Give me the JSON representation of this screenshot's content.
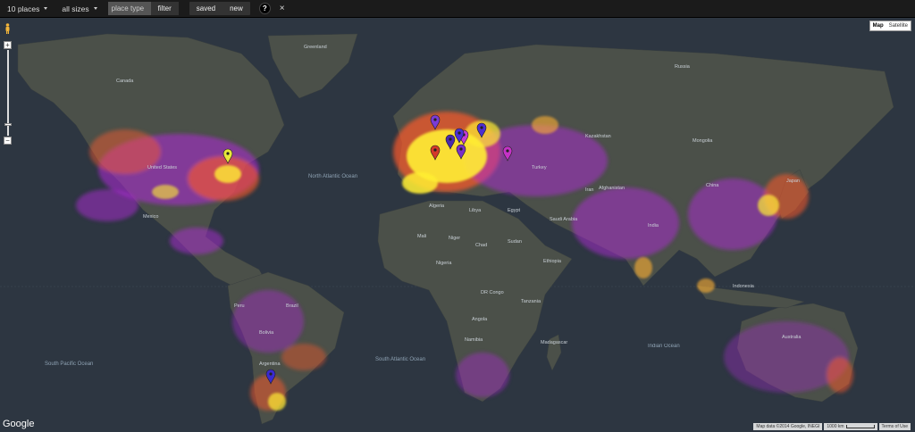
{
  "toolbar": {
    "places": "10 places",
    "sizes": "all sizes",
    "place_type_placeholder": "place type",
    "filter": "filter",
    "saved": "saved",
    "new": "new",
    "help": "?",
    "close": "×"
  },
  "map_type": {
    "map": "Map",
    "satellite": "Satellite"
  },
  "zoom": {
    "in": "+",
    "out": "−"
  },
  "google_logo": "Google",
  "attribution": {
    "data": "Map data ©2014 Google, INEGI",
    "scale": "1000 km",
    "terms": "Terms of Use"
  },
  "oceans": [
    {
      "id": "north-atlantic",
      "text": "North Atlantic Ocean"
    },
    {
      "id": "south-atlantic",
      "text": "South Atlantic Ocean"
    },
    {
      "id": "south-pacific",
      "text": "South Pacific Ocean"
    },
    {
      "id": "indian",
      "text": "Indian Ocean"
    }
  ],
  "countries": [
    "Greenland",
    "Canada",
    "United States",
    "Mexico",
    "Peru",
    "Brazil",
    "Bolivia",
    "Argentina",
    "Algeria",
    "Libya",
    "Egypt",
    "Mali",
    "Niger",
    "Chad",
    "Sudan",
    "Nigeria",
    "DR Congo",
    "Tanzania",
    "Angola",
    "Namibia",
    "Madagascar",
    "Russia",
    "Kazakhstan",
    "Mongolia",
    "China",
    "India",
    "Saudi Arabia",
    "Iran",
    "Turkey",
    "Australia",
    "Indonesia",
    "Ethiopia",
    "Afghanistan",
    "Japan"
  ],
  "colors": {
    "heat_high": "#ffee33",
    "heat_mid": "#ff5a2a",
    "heat_low": "#b02ad8",
    "land": "#4a4f49",
    "ocean": "#2d3641"
  },
  "markers": [
    {
      "id": "new-york",
      "color": "#e8e83a"
    },
    {
      "id": "paris",
      "color": "#7a3bd6"
    },
    {
      "id": "london",
      "color": "#c23bd6"
    },
    {
      "id": "barcelona",
      "color": "#d43a2a"
    },
    {
      "id": "rome",
      "color": "#4a2ab0"
    },
    {
      "id": "munich",
      "color": "#4a30d6"
    },
    {
      "id": "vienna",
      "color": "#7a30c6"
    },
    {
      "id": "budapest",
      "color": "#4d2fd0"
    },
    {
      "id": "istanbul",
      "color": "#c432c6"
    },
    {
      "id": "buenos-aires",
      "color": "#3a2ad0"
    }
  ]
}
